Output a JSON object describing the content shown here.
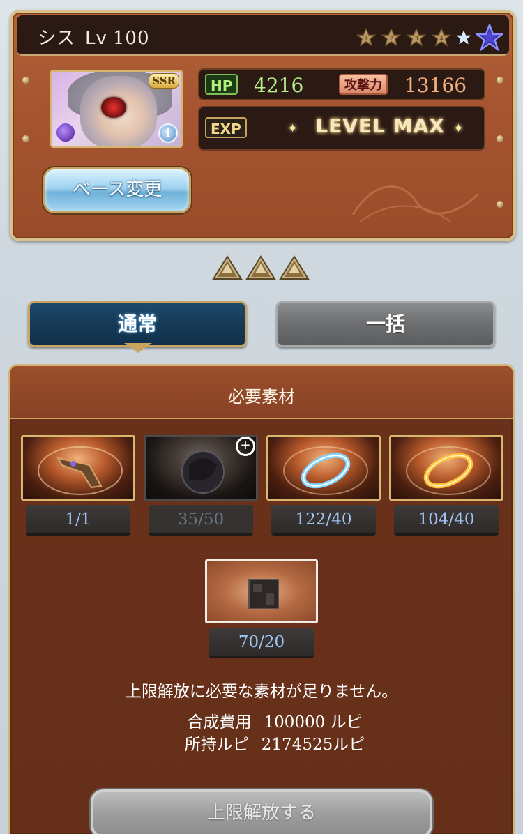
{
  "character": {
    "name": "シス",
    "level_label": "Lv",
    "level": "100",
    "rarity": "SSR",
    "stars_filled": 4,
    "stars_total": 5,
    "hp_label": "HP",
    "hp": "4216",
    "atk_label": "攻撃力",
    "atk": "13166",
    "exp_label": "EXP",
    "exp_status": "LEVEL MAX",
    "base_change_button": "ベース変更",
    "info_icon": "i"
  },
  "uncap_level": 3,
  "modes": {
    "normal": "通常",
    "bulk": "一括",
    "selected": "normal"
  },
  "materials": {
    "title": "必要素材",
    "items": [
      {
        "icon": "gauntlet-icon",
        "count": "1/1",
        "available": true
      },
      {
        "icon": "dark-orb-icon",
        "count": "35/50",
        "available": false
      },
      {
        "icon": "blue-ring-icon",
        "count": "122/40",
        "available": true
      },
      {
        "icon": "gold-ring-icon",
        "count": "104/40",
        "available": true
      },
      {
        "icon": "black-cube-icon",
        "count": "70/20",
        "available": true
      }
    ],
    "warning": "上限解放に必要な素材が足りません。",
    "cost_label": "合成費用",
    "cost_value": "100000 ルピ",
    "owned_label": "所持ルピ",
    "owned_value": "2174525ルピ",
    "uncap_button": "上限解放する"
  },
  "colors": {
    "panel_brown": "#a65530",
    "gold_border": "#d9c089",
    "count_blue": "#9fc4f2",
    "hp_green": "#b7ef8b",
    "atk_orange": "#f4b07f",
    "mode_selected": "#163955"
  }
}
